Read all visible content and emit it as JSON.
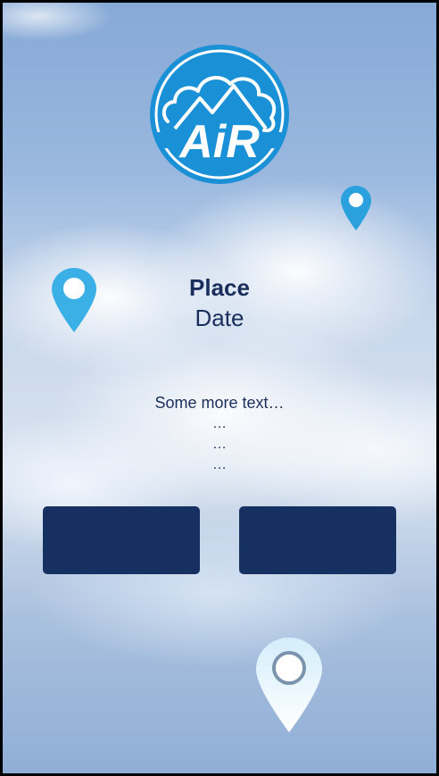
{
  "logo": {
    "text": "AiR",
    "icon": "mountain-cloud-logo",
    "colors": {
      "primary": "#1a90d6",
      "inner": "#ffffff"
    }
  },
  "event": {
    "place": "Place",
    "date": "Date"
  },
  "details": {
    "text": "Some more text…",
    "lines": [
      "…",
      "…",
      "…"
    ]
  },
  "buttons": {
    "left_label": "",
    "right_label": ""
  },
  "pins": {
    "top_right_icon": "location-pin-icon",
    "left_icon": "location-pin-icon",
    "bottom_icon": "location-pin-icon",
    "color_blue": "#2aa1dd",
    "color_light": "#e8f6fd"
  },
  "colors": {
    "text": "#1a2e5c",
    "button": "#163161"
  }
}
